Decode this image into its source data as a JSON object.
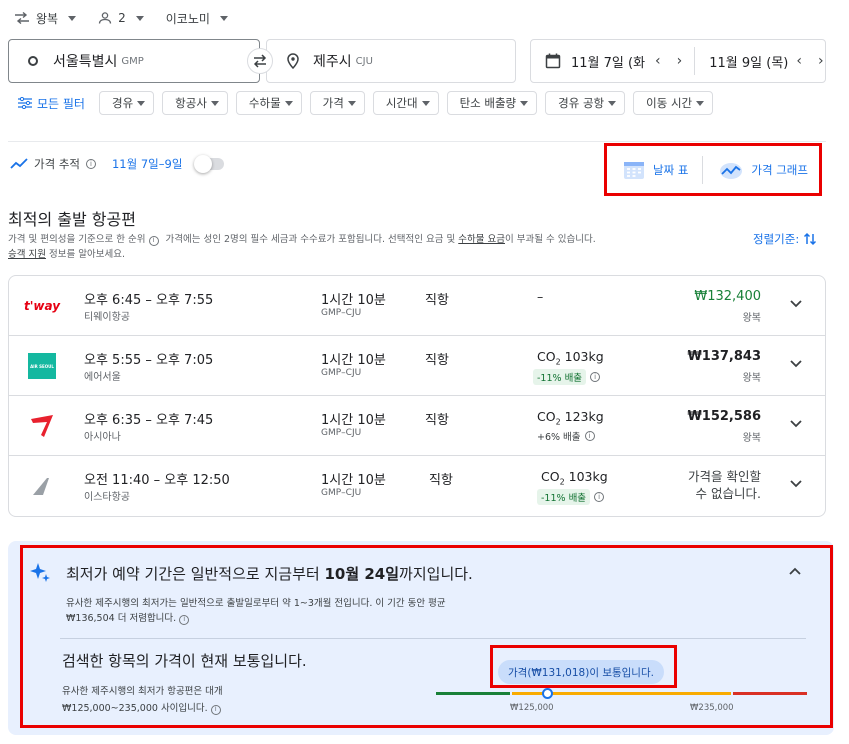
{
  "trip": {
    "type": "왕복",
    "passengers": "2",
    "cabin": "이코노미"
  },
  "search": {
    "origin_name": "서울특별시",
    "origin_code": "GMP",
    "dest_name": "제주시",
    "dest_code": "CJU",
    "depart_date": "11월 7일 (화",
    "return_date": "11월 9일 (목)"
  },
  "filters": {
    "all": "모든 필터",
    "chips": [
      "경유",
      "항공사",
      "수하물",
      "가격",
      "시간대",
      "탄소 배출량",
      "경유 공항",
      "이동 시간"
    ]
  },
  "tracking": {
    "label": "가격 추적",
    "dates": "11월 7일–9일"
  },
  "views": {
    "date_grid": "날짜 표",
    "price_graph": "가격 그래프"
  },
  "results": {
    "title": "최적의 출발 항공편",
    "note_a": "가격 및 편의성을 기준으로 한 순위",
    "note_b": "가격에는 성인 2명의 필수 세금과 수수료가 포함됩니다. 선택적인 요금 및",
    "note_link1": "수하물 요금",
    "note_c": "이 부과될 수 있습니다.",
    "note_link2": "승객 지원",
    "note_d": "정보를 알아보세요.",
    "sort_label": "정렬기준:"
  },
  "flights": [
    {
      "times": "오후 6:45 – 오후 7:55",
      "airline": "티웨이항공",
      "logo_text": "t'way",
      "duration": "1시간 10분",
      "route": "GMP–CJU",
      "stops": "직항",
      "co2": "–",
      "emissions": "",
      "price": "₩132,400",
      "trip_type": "왕복"
    },
    {
      "times": "오후 5:55 – 오후 7:05",
      "airline": "에어서울",
      "logo_text": "AIR SEOUL",
      "duration": "1시간 10분",
      "route": "GMP–CJU",
      "stops": "직항",
      "co2_prefix": "CO",
      "co2_sub": "2",
      "co2_val": "103kg",
      "emissions": "-11% 배출",
      "price": "₩137,843",
      "trip_type": "왕복"
    },
    {
      "times": "오후 6:35 – 오후 7:45",
      "airline": "아시아나",
      "duration": "1시간 10분",
      "route": "GMP–CJU",
      "stops": "직항",
      "co2_prefix": "CO",
      "co2_sub": "2",
      "co2_val": "123kg",
      "emissions": "+6% 배출",
      "price": "₩152,586",
      "trip_type": "왕복"
    },
    {
      "times": "오전 11:40 – 오후 12:50",
      "airline": "이스타항공",
      "duration": "1시간 10분",
      "route": "GMP–CJU",
      "stops": "직항",
      "co2_prefix": "CO",
      "co2_sub": "2",
      "co2_val": "103kg",
      "emissions": "-11% 배출",
      "price_unavailable_1": "가격을 확인할",
      "price_unavailable_2": "수 없습니다."
    }
  ],
  "insights": {
    "title_a": "최저가 예약 기간은 일반적으로 지금부터",
    "title_b": "10월 24일",
    "title_c": "까지입니다.",
    "text_1": "유사한 제주시행의 최저가는 일반적으로 출발일로부터 약 1~3개월 전입니다. 이 기간 동안 평균",
    "text_2": "₩136,504 더 저렴합니다.",
    "subtitle": "검색한 항목의 가격이 현재 보통입니다.",
    "range_1": "유사한 제주시행의 최저가 항공편은 대개",
    "range_2": "₩125,000~235,000 사이입니다.",
    "badge": "가격(₩131,018)이 보통입니다.",
    "low_label": "₩125,000",
    "high_label": "₩235,000",
    "current_price": 131018,
    "range_low": 125000,
    "range_high": 235000
  },
  "colors": {
    "accent": "#1a73e8",
    "highlight_border": "#ea0000",
    "good": "#188038",
    "typical": "#f9ab00",
    "high": "#d93025"
  }
}
